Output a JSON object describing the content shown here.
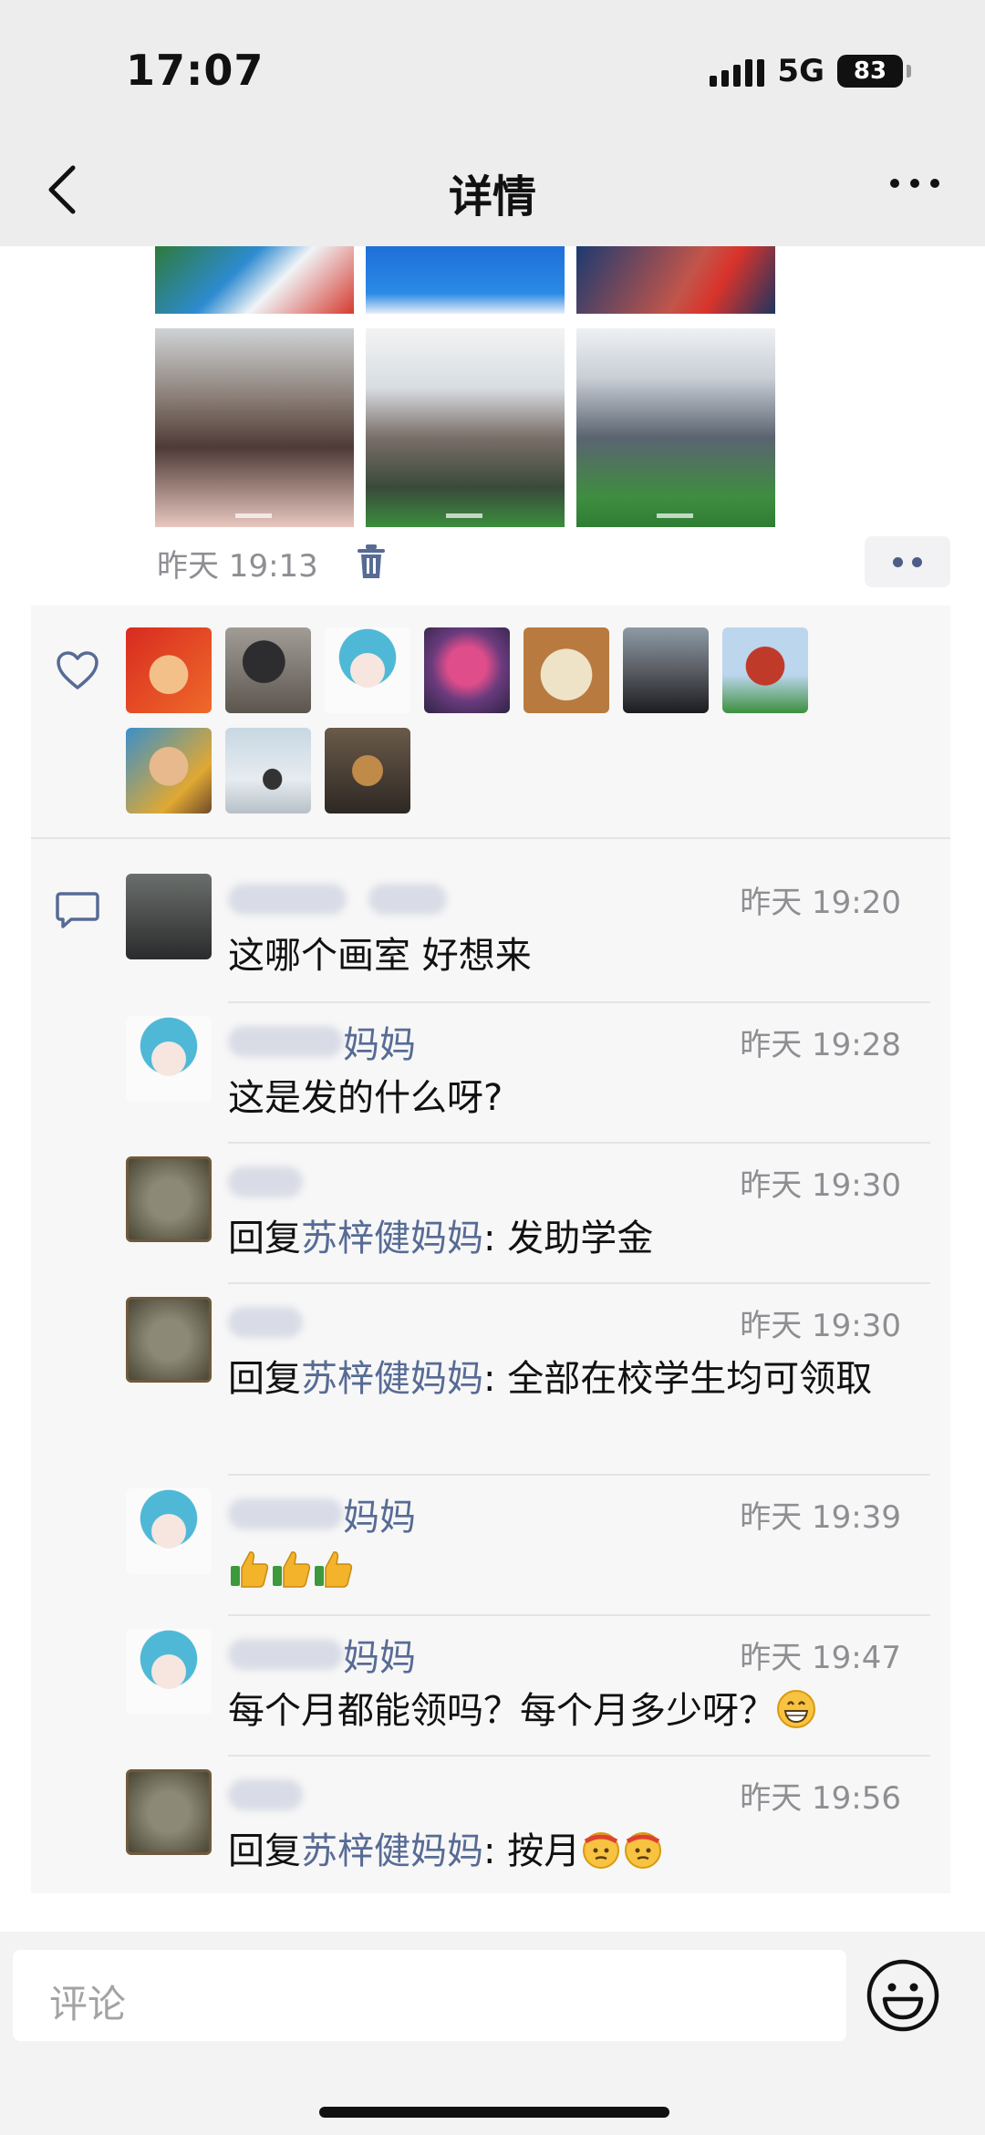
{
  "status_bar": {
    "time": "17:07",
    "network": "5G",
    "battery": "83"
  },
  "header": {
    "title": "详情",
    "back_icon": "back-chevron-icon",
    "more_icon": "more-dots-icon"
  },
  "post": {
    "time": "昨天 19:13",
    "photos": [
      "photo-1",
      "photo-2",
      "photo-3",
      "photo-4",
      "photo-5",
      "photo-6"
    ]
  },
  "likes": {
    "icon": "heart-icon",
    "avatars": [
      "avatar-1",
      "avatar-2",
      "avatar-3",
      "avatar-4",
      "avatar-5",
      "avatar-6",
      "avatar-7",
      "avatar-8",
      "avatar-9",
      "avatar-10"
    ]
  },
  "comments": [
    {
      "name_suffix": "",
      "time": "昨天 19:20",
      "reply_prefix": "",
      "reply_to": "",
      "text": "这哪个画室 好想来"
    },
    {
      "name_suffix": "妈妈",
      "time": "昨天 19:28",
      "reply_prefix": "",
      "reply_to": "",
      "text": "这是发的什么呀?"
    },
    {
      "name_suffix": "",
      "time": "昨天 19:30",
      "reply_prefix": "回复",
      "reply_to": "苏梓健妈妈",
      "text": ": 发助学金"
    },
    {
      "name_suffix": "",
      "time": "昨天 19:30",
      "reply_prefix": "回复",
      "reply_to": "苏梓健妈妈",
      "text": ": 全部在校学生均可领取"
    },
    {
      "name_suffix": "妈妈",
      "time": "昨天 19:39",
      "reply_prefix": "",
      "reply_to": "",
      "text": ""
    },
    {
      "name_suffix": "妈妈",
      "time": "昨天 19:47",
      "reply_prefix": "",
      "reply_to": "",
      "text": "每个月都能领吗？每个月多少呀？"
    },
    {
      "name_suffix": "",
      "time": "昨天 19:56",
      "reply_prefix": "回复",
      "reply_to": "苏梓健妈妈",
      "text": ": 按月"
    }
  ],
  "composer": {
    "placeholder": "评论",
    "emoji_icon": "smiley-icon"
  },
  "colors": {
    "link": "#576b95",
    "panel": "#f7f7f7",
    "time": "#8e8e93"
  }
}
